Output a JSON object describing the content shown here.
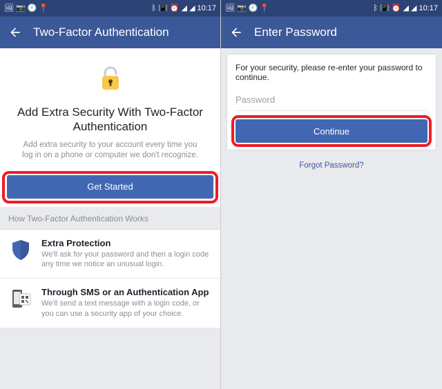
{
  "status": {
    "time": "10:17",
    "left_icons": [
      "image-icon",
      "camera-icon",
      "clock-small-icon",
      "map-small-icon"
    ],
    "right_icons": [
      "bluetooth-icon",
      "vibrate-icon",
      "alarm-ring-icon",
      "network-icon",
      "signal-icon"
    ]
  },
  "left": {
    "appbar_title": "Two-Factor Authentication",
    "hero_title": "Add Extra Security With Two-Factor Authentication",
    "hero_desc": "Add extra security to your account every time you log in on a phone or computer we don't recognize.",
    "get_started_label": "Get Started",
    "section_header": "How Two-Factor Authentication Works",
    "rows": [
      {
        "title": "Extra Protection",
        "desc": "We'll ask for your password and then a login code any time we notice an unusual login."
      },
      {
        "title": "Through SMS or an Authentication App",
        "desc": "We'll send a text message with a login code, or you can use a security app of your choice."
      }
    ]
  },
  "right": {
    "appbar_title": "Enter Password",
    "message": "For your security, please re-enter your password to continue.",
    "password_placeholder": "Password",
    "continue_label": "Continue",
    "forgot_label": "Forgot Password?"
  }
}
